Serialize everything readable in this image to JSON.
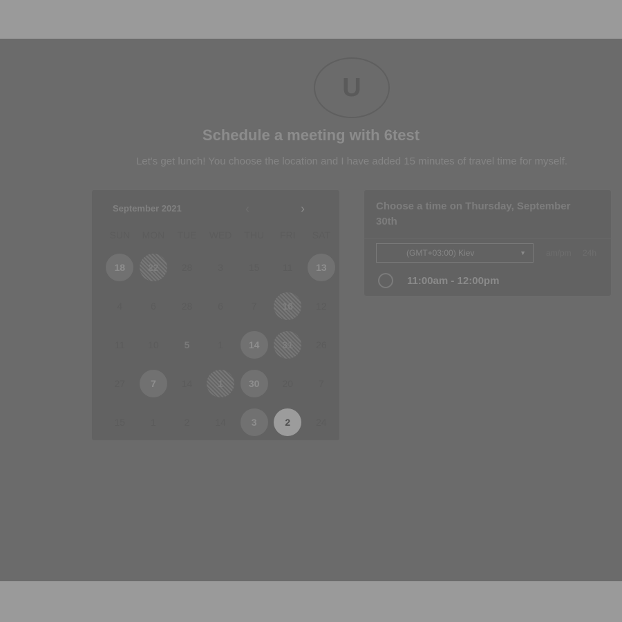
{
  "header": {
    "avatar_letter": "U",
    "title": "Schedule a meeting with 6test",
    "subtitle": "Let's get lunch! You choose the location and I have added 15 minutes of travel time for myself."
  },
  "calendar": {
    "month": "September 2021",
    "prev_icon": "chevron-left-icon",
    "next_icon": "chevron-right-icon",
    "weekdays": [
      "SUN",
      "MON",
      "TUE",
      "WED",
      "THU",
      "FRI",
      "SAT"
    ],
    "weeks": [
      [
        "18",
        "22",
        "28",
        "3",
        "15",
        "11",
        "13"
      ],
      [
        "4",
        "6",
        "28",
        "6",
        "7",
        "16",
        "12"
      ],
      [
        "11",
        "10",
        "5",
        "1",
        "14",
        "31",
        "26"
      ],
      [
        "27",
        "7",
        "14",
        "1",
        "30",
        "20",
        "7"
      ],
      [
        "15",
        "1",
        "2",
        "14",
        "3",
        "2",
        "24"
      ]
    ]
  },
  "time_panel": {
    "heading": "Choose a time on Thursday, September 30th",
    "timezone": "(GMT+03:00) Kiev",
    "format_ampm": "am/pm",
    "format_24h": "24h",
    "slots": [
      "11:00am - 12:00pm"
    ]
  },
  "colors": {
    "overlay": "#6b6b6b",
    "band": "#9a9a9a",
    "card": "#626262"
  }
}
